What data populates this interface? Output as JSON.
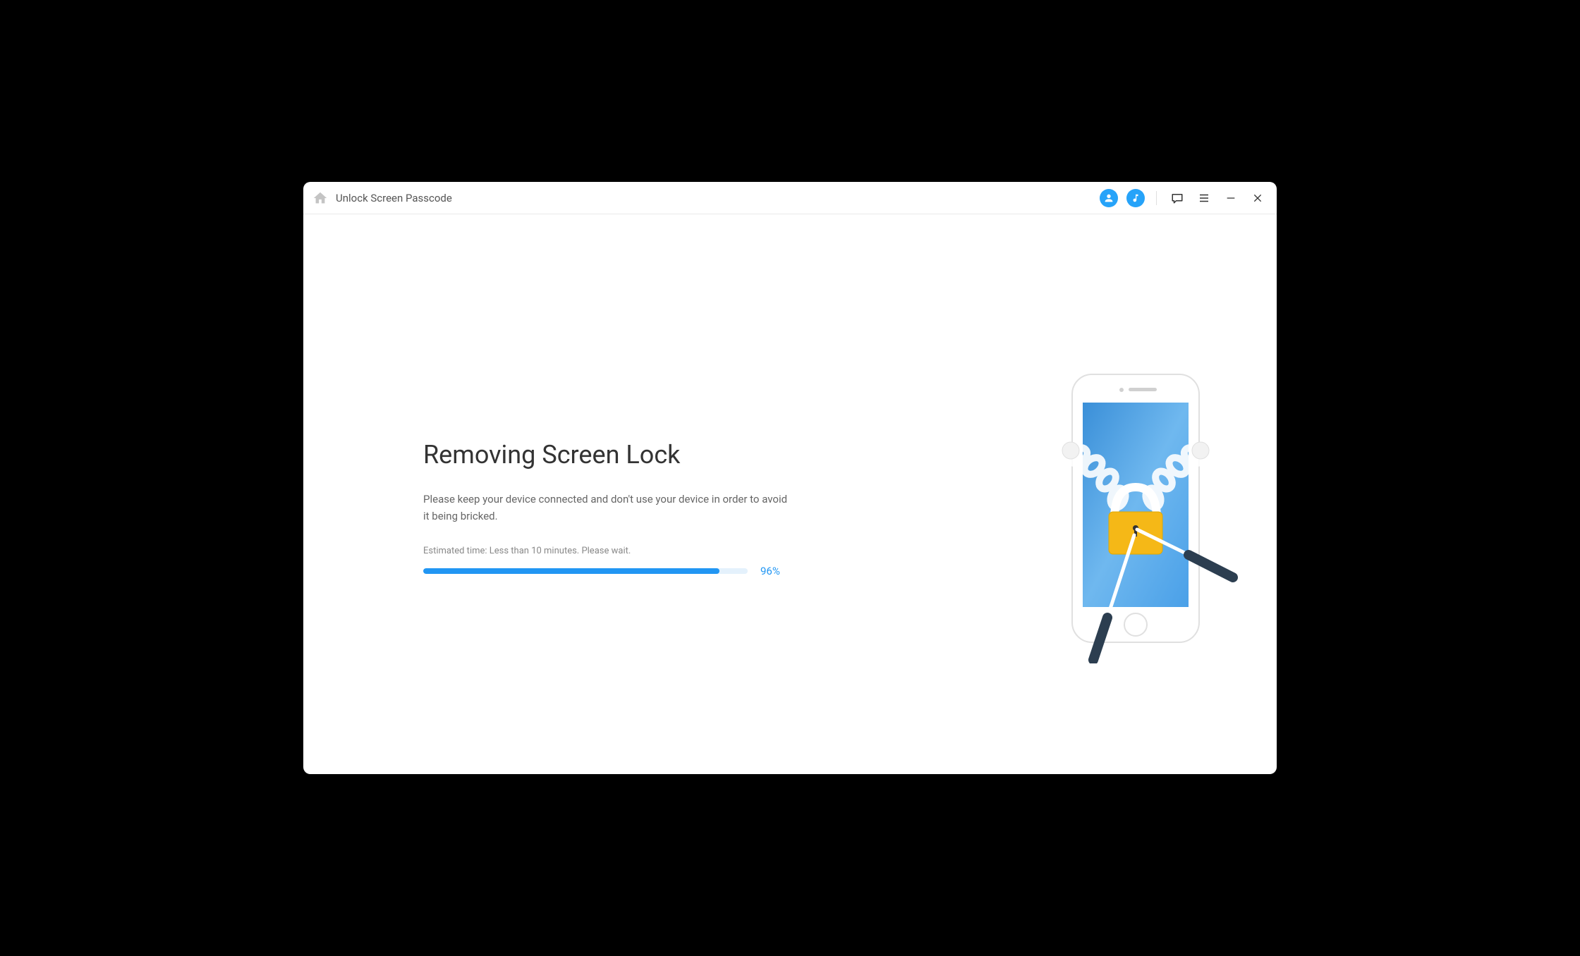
{
  "header": {
    "title": "Unlock Screen Passcode"
  },
  "main": {
    "heading": "Removing Screen Lock",
    "description": "Please keep your device connected and don't use your device in order to avoid it being bricked.",
    "estimate": "Estimated time: Less than 10 minutes. Please wait.",
    "progress": {
      "percent": 96,
      "percent_label": "96%"
    }
  },
  "colors": {
    "accent": "#2196f3",
    "accent_light": "#26a3f9"
  }
}
